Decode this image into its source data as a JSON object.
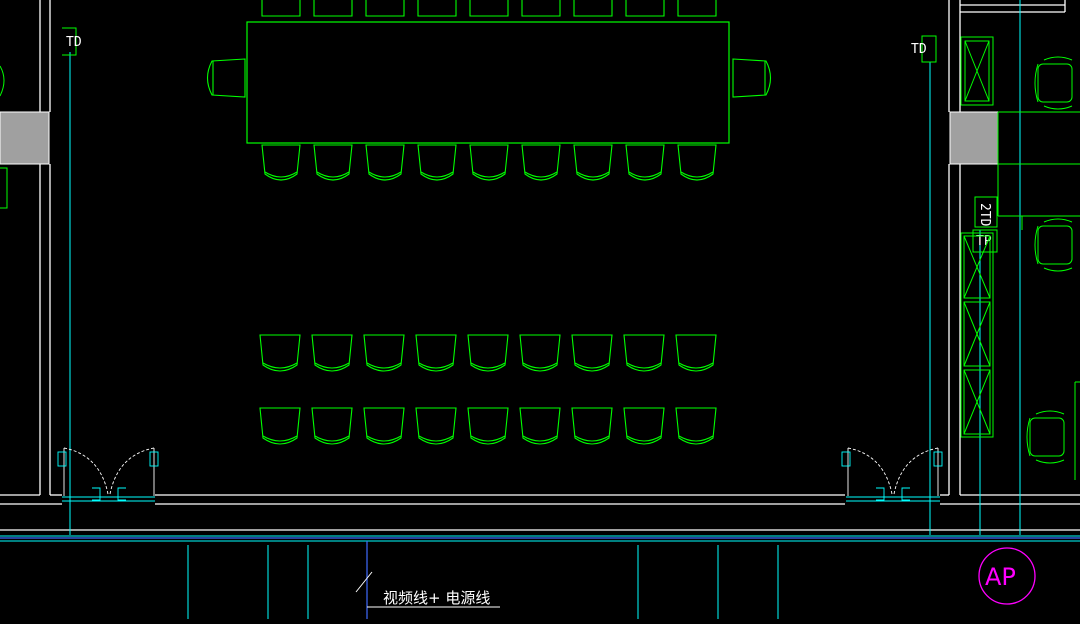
{
  "labels": {
    "td_left": "TD",
    "td_right": "TD",
    "td_vertical": "2TD",
    "tp": "TP",
    "cable_note": "视频线+ 电源线",
    "ap": "AP"
  },
  "colors": {
    "background": "#000000",
    "wall": "#ffffff",
    "furniture": "#00ff00",
    "axis": "#00ffff",
    "cable": "#3f6bff",
    "ap": "#ff00ff",
    "column_fill": "#a0a0a0"
  }
}
